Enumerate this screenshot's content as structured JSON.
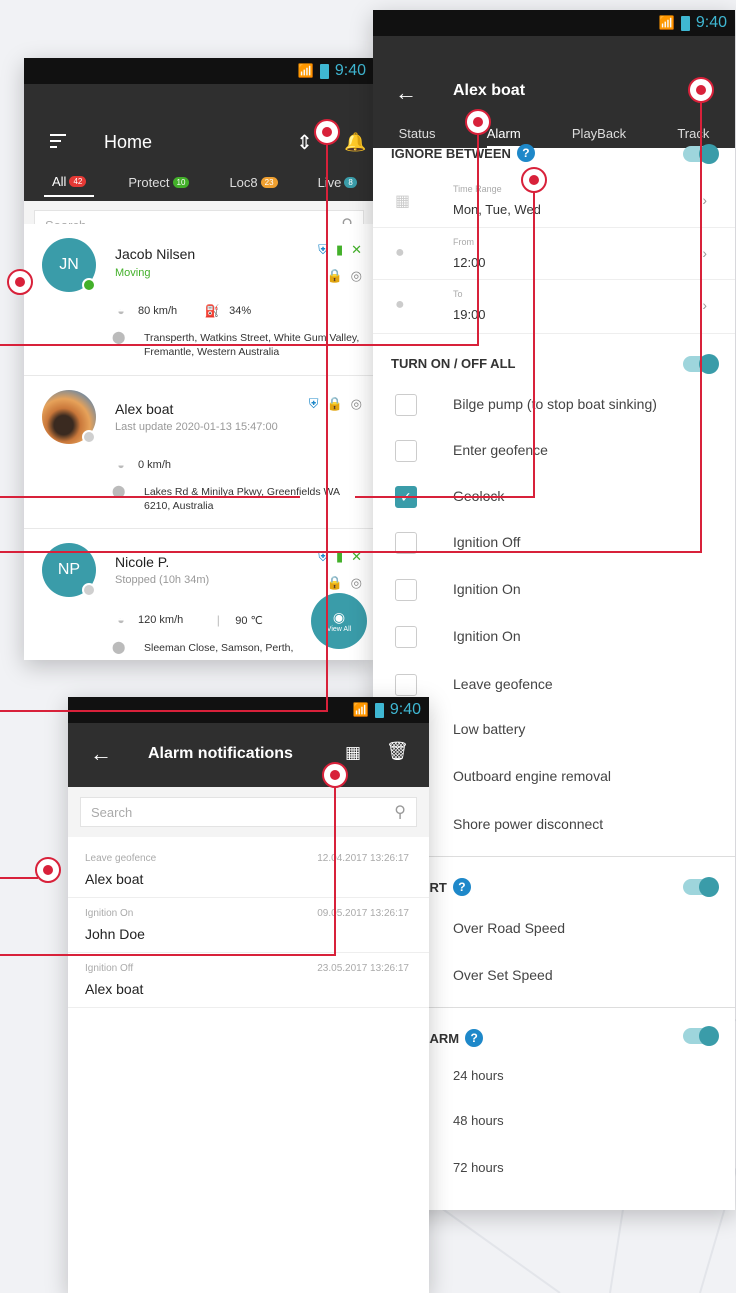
{
  "status_bar": {
    "time": "9:40"
  },
  "home": {
    "title": "Home",
    "tabs": [
      {
        "label": "All",
        "count": "42",
        "color": "#e53935"
      },
      {
        "label": "Protect",
        "count": "10",
        "color": "#43b02a"
      },
      {
        "label": "Loc8",
        "count": "23",
        "color": "#f0a030"
      },
      {
        "label": "Live",
        "count": "8",
        "color": "#3a9ca9"
      }
    ],
    "search_placeholder": "Search",
    "cards": [
      {
        "initials": "JN",
        "name": "Jacob Nilsen",
        "status": "Moving",
        "speed": "80 km/h",
        "fuel": "34%",
        "address": "Transperth, Watkins Street, White Gum Valley, Fremantle, Western Australia"
      },
      {
        "name": "Alex boat",
        "status": "Last update 2020-01-13 15:47:00",
        "speed": "0 km/h",
        "address": "Lakes Rd & Minilya Pkwy, Greenfields WA 6210, Australia"
      },
      {
        "initials": "NP",
        "name": "Nicole P.",
        "status": "Stopped (10h 34m)",
        "speed": "120 km/h",
        "temperature": "90 ℃",
        "address": "Sleeman Close, Samson, Perth,"
      }
    ],
    "view_all": "View All"
  },
  "detail": {
    "title": "Alex boat",
    "tabs": [
      "Status",
      "Alarm",
      "PlayBack",
      "Track"
    ],
    "ignore_between": "IGNORE BETWEEN",
    "time_rows": [
      {
        "label": "Time Range",
        "value": "Mon, Tue, Wed"
      },
      {
        "label": "From",
        "value": "12:00"
      },
      {
        "label": "To",
        "value": "19:00"
      }
    ],
    "turn_all": "TURN ON / OFF ALL",
    "alarms": [
      "Bilge pump (to stop boat sinking)",
      "Enter geofence",
      "Geolock",
      "Ignition Off",
      "Ignition On",
      "Ignition On",
      "Leave geofence",
      "Low battery",
      "Outboard engine removal",
      "Shore power disconnect"
    ],
    "speed_alert": "D ALERT",
    "speed_items": [
      "Over Road Speed",
      "Over Set Speed"
    ],
    "engine_alarm": "NE ALARM",
    "engine_items": [
      "24 hours",
      "48 hours",
      "72 hours"
    ]
  },
  "notifications": {
    "title": "Alarm notifications",
    "search_placeholder": "Search",
    "items": [
      {
        "type": "Leave geofence",
        "date": "12.04.2017   13:26:17",
        "name": "Alex boat"
      },
      {
        "type": "Ignition On",
        "date": "09.05.2017   13:26:17",
        "name": "John Doe"
      },
      {
        "type": "Ignition Off",
        "date": "23.05.2017   13:26:17",
        "name": "Alex boat"
      }
    ]
  },
  "colors": {
    "accent": "#3a9ca9",
    "callout": "#d8213a",
    "toolbar": "#2f2f2f"
  }
}
